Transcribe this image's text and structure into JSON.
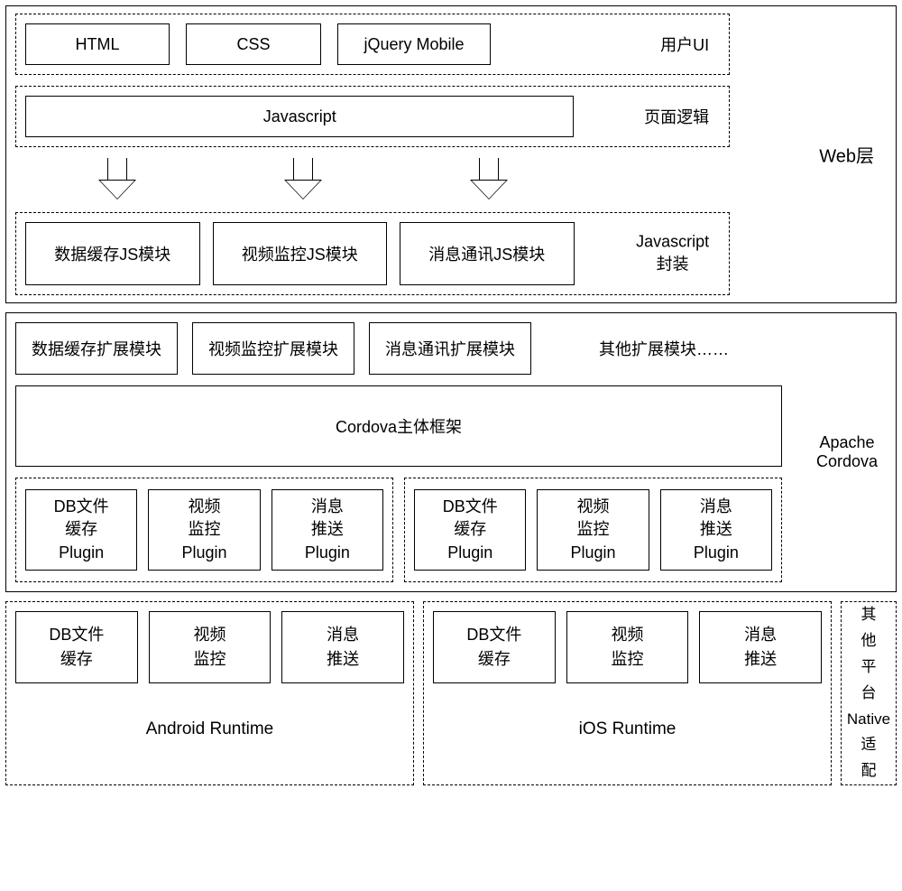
{
  "web": {
    "title": "Web层",
    "ui": {
      "label": "用户UI",
      "items": [
        "HTML",
        "CSS",
        "jQuery Mobile"
      ]
    },
    "logic": {
      "label": "页面逻辑",
      "item": "Javascript"
    },
    "jswrap": {
      "label": "Javascript\n封装",
      "items": [
        "数据缓存JS模块",
        "视频监控JS模块",
        "消息通讯JS模块"
      ]
    }
  },
  "apache": {
    "label": "Apache\nCordova",
    "ext": {
      "items": [
        "数据缓存扩展模块",
        "视频监控扩展模块",
        "消息通讯扩展模块"
      ],
      "other": "其他扩展模块……"
    },
    "main": "Cordova主体框架",
    "plugins": {
      "android": [
        "DB文件\n缓存\nPlugin",
        "视频\n监控\nPlugin",
        "消息\n推送\nPlugin"
      ],
      "ios": [
        "DB文件\n缓存\nPlugin",
        "视频\n监控\nPlugin",
        "消息\n推送\nPlugin"
      ]
    }
  },
  "runtime": {
    "android": {
      "label": "Android Runtime",
      "items": [
        "DB文件\n缓存",
        "视频\n监控",
        "消息\n推送"
      ]
    },
    "ios": {
      "label": "iOS Runtime",
      "items": [
        "DB文件\n缓存",
        "视频\n监控",
        "消息\n推送"
      ]
    },
    "other": "其\n他\n平\n台\nNative\n适\n配"
  }
}
